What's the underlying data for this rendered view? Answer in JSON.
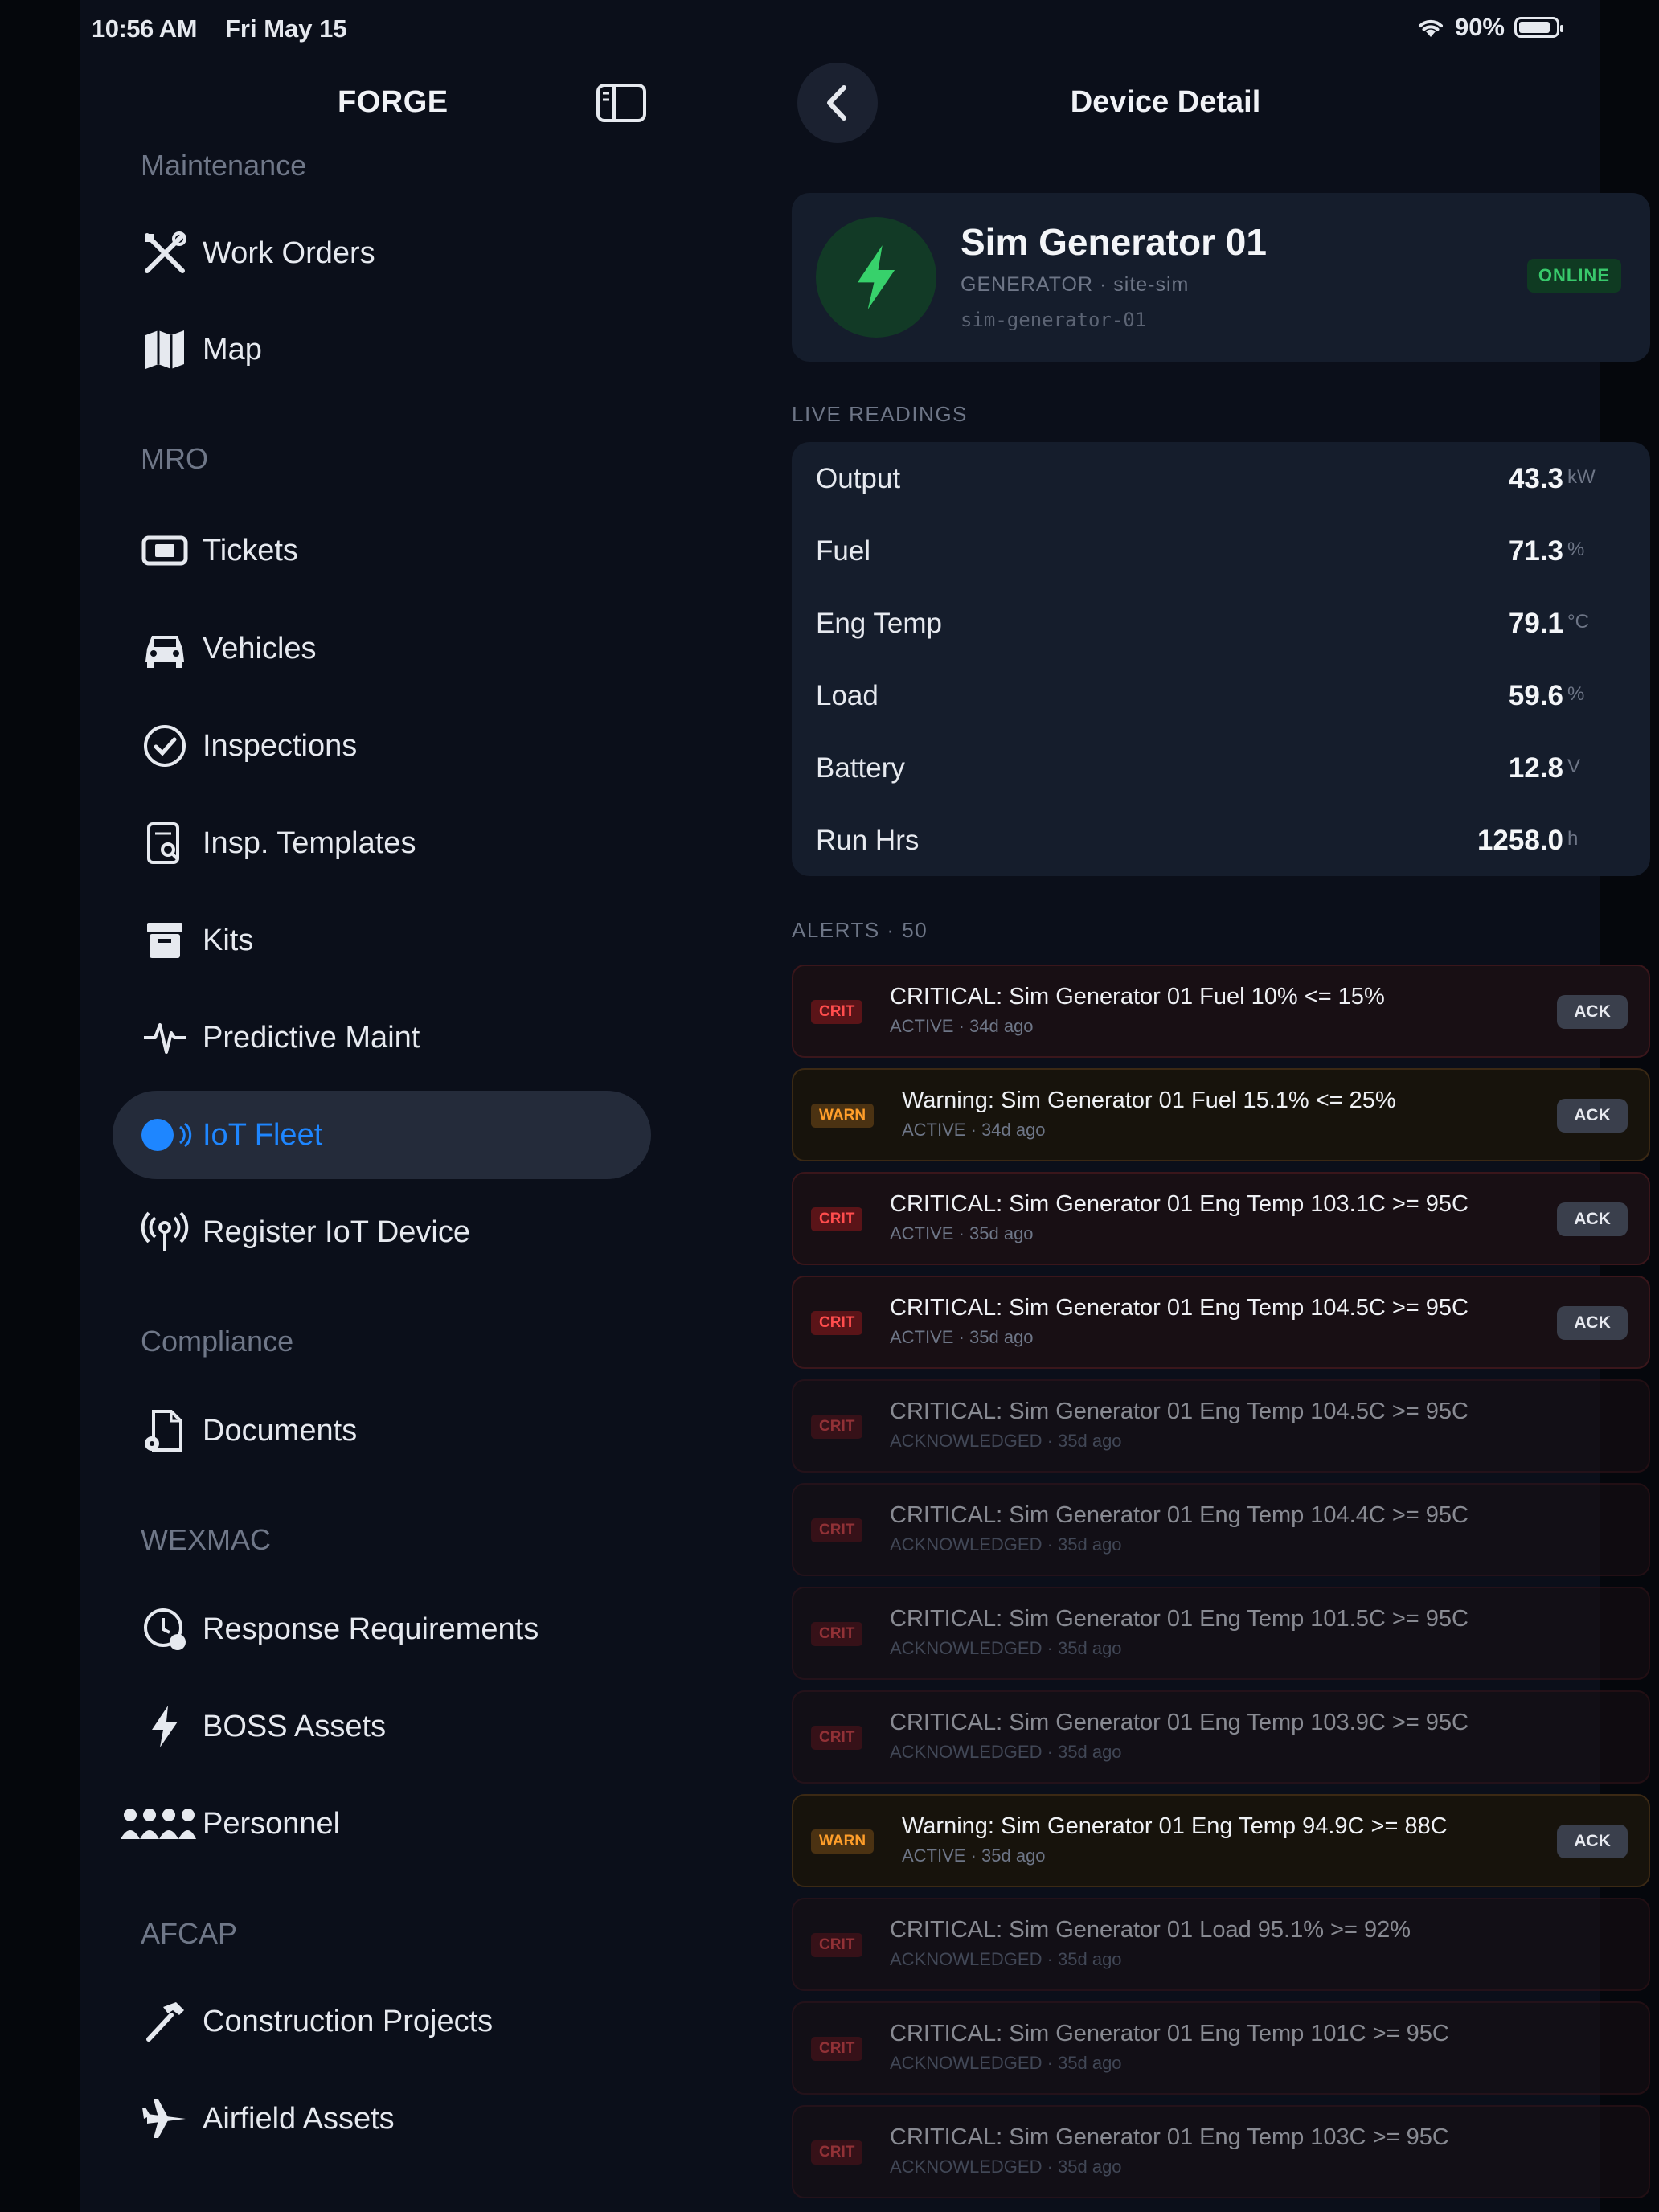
{
  "status_bar": {
    "time": "10:56 AM",
    "date": "Fri May 15",
    "battery": "90%"
  },
  "sidebar": {
    "title": "FORGE",
    "sections": {
      "maintenance": "Maintenance",
      "mro": "MRO",
      "compliance": "Compliance",
      "wexmac": "WEXMAC",
      "afcap": "AFCAP"
    },
    "items": [
      {
        "label": "Work Orders",
        "icon": "tools-icon"
      },
      {
        "label": "Map",
        "icon": "map-icon"
      },
      {
        "label": "Tickets",
        "icon": "ticket-icon"
      },
      {
        "label": "Vehicles",
        "icon": "car-icon"
      },
      {
        "label": "Inspections",
        "icon": "check-badge-icon"
      },
      {
        "label": "Insp. Templates",
        "icon": "clipboard-search-icon"
      },
      {
        "label": "Kits",
        "icon": "archive-box-icon"
      },
      {
        "label": "Predictive Maint",
        "icon": "waveform-icon"
      },
      {
        "label": "IoT Fleet",
        "icon": "broadcast-dot-icon",
        "active": true
      },
      {
        "label": "Register IoT Device",
        "icon": "antenna-icon"
      },
      {
        "label": "Documents",
        "icon": "document-gear-icon"
      },
      {
        "label": "Response Requirements",
        "icon": "clock-badge-icon"
      },
      {
        "label": "BOSS Assets",
        "icon": "bolt-icon"
      },
      {
        "label": "Personnel",
        "icon": "people-icon"
      },
      {
        "label": "Construction Projects",
        "icon": "hammer-icon"
      },
      {
        "label": "Airfield Assets",
        "icon": "airplane-icon"
      }
    ]
  },
  "detail": {
    "title": "Device Detail",
    "device": {
      "name": "Sim Generator 01",
      "subtitle": "GENERATOR · site-sim",
      "id": "sim-generator-01",
      "status": "ONLINE",
      "accent": "#37d16b"
    },
    "readings_label": "LIVE READINGS",
    "readings": [
      {
        "name": "Output",
        "value": "43.3",
        "unit": "kW"
      },
      {
        "name": "Fuel",
        "value": "71.3",
        "unit": "%"
      },
      {
        "name": "Eng Temp",
        "value": "79.1",
        "unit": "°C"
      },
      {
        "name": "Load",
        "value": "59.6",
        "unit": "%"
      },
      {
        "name": "Battery",
        "value": "12.8",
        "unit": "V"
      },
      {
        "name": "Run Hrs",
        "value": "1258.0",
        "unit": "h"
      }
    ],
    "alerts_label": "ALERTS · 50",
    "ack_label": "ACK",
    "alerts": [
      {
        "severity": "CRIT",
        "message": "CRITICAL: Sim Generator 01 Fuel 10% <= 15%",
        "meta": "ACTIVE · 34d ago",
        "active": true
      },
      {
        "severity": "WARN",
        "message": "Warning: Sim Generator 01 Fuel 15.1% <= 25%",
        "meta": "ACTIVE · 34d ago",
        "active": true
      },
      {
        "severity": "CRIT",
        "message": "CRITICAL: Sim Generator 01 Eng Temp 103.1C >= 95C",
        "meta": "ACTIVE · 35d ago",
        "active": true
      },
      {
        "severity": "CRIT",
        "message": "CRITICAL: Sim Generator 01 Eng Temp 104.5C >= 95C",
        "meta": "ACTIVE · 35d ago",
        "active": true
      },
      {
        "severity": "CRIT",
        "message": "CRITICAL: Sim Generator 01 Eng Temp 104.5C >= 95C",
        "meta": "ACKNOWLEDGED · 35d ago",
        "active": false
      },
      {
        "severity": "CRIT",
        "message": "CRITICAL: Sim Generator 01 Eng Temp 104.4C >= 95C",
        "meta": "ACKNOWLEDGED · 35d ago",
        "active": false
      },
      {
        "severity": "CRIT",
        "message": "CRITICAL: Sim Generator 01 Eng Temp 101.5C >= 95C",
        "meta": "ACKNOWLEDGED · 35d ago",
        "active": false
      },
      {
        "severity": "CRIT",
        "message": "CRITICAL: Sim Generator 01 Eng Temp 103.9C >= 95C",
        "meta": "ACKNOWLEDGED · 35d ago",
        "active": false
      },
      {
        "severity": "WARN",
        "message": "Warning: Sim Generator 01 Eng Temp 94.9C >= 88C",
        "meta": "ACTIVE · 35d ago",
        "active": true
      },
      {
        "severity": "CRIT",
        "message": "CRITICAL: Sim Generator 01 Load 95.1% >= 92%",
        "meta": "ACKNOWLEDGED · 35d ago",
        "active": false
      },
      {
        "severity": "CRIT",
        "message": "CRITICAL: Sim Generator 01 Eng Temp 101C >= 95C",
        "meta": "ACKNOWLEDGED · 35d ago",
        "active": false
      },
      {
        "severity": "CRIT",
        "message": "CRITICAL: Sim Generator 01 Eng Temp 103C >= 95C",
        "meta": "ACKNOWLEDGED · 35d ago",
        "active": false
      }
    ]
  }
}
